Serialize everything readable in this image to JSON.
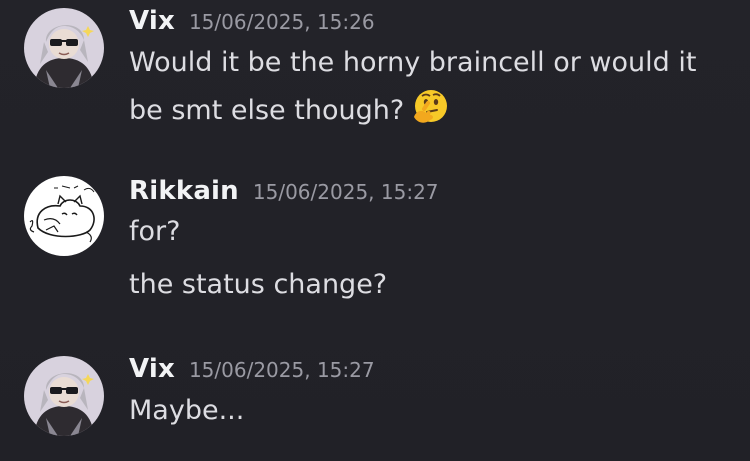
{
  "messages": [
    {
      "username": "Vix",
      "timestamp": "15/06/2025, 15:26",
      "lines": [
        "Would it be the horny braincell or would it",
        "be smt else though?"
      ],
      "emoji": "thinking-face-emoji"
    },
    {
      "username": "Rikkain",
      "timestamp": "15/06/2025, 15:27",
      "lines": [
        "for?",
        "the status change?"
      ]
    },
    {
      "username": "Vix",
      "timestamp": "15/06/2025, 15:27",
      "lines": [
        "Maybe..."
      ]
    }
  ],
  "colors": {
    "background": "#222229",
    "username": "#f2f3f5",
    "timestamp": "#9a9aa3",
    "message_text": "#dddde2"
  }
}
